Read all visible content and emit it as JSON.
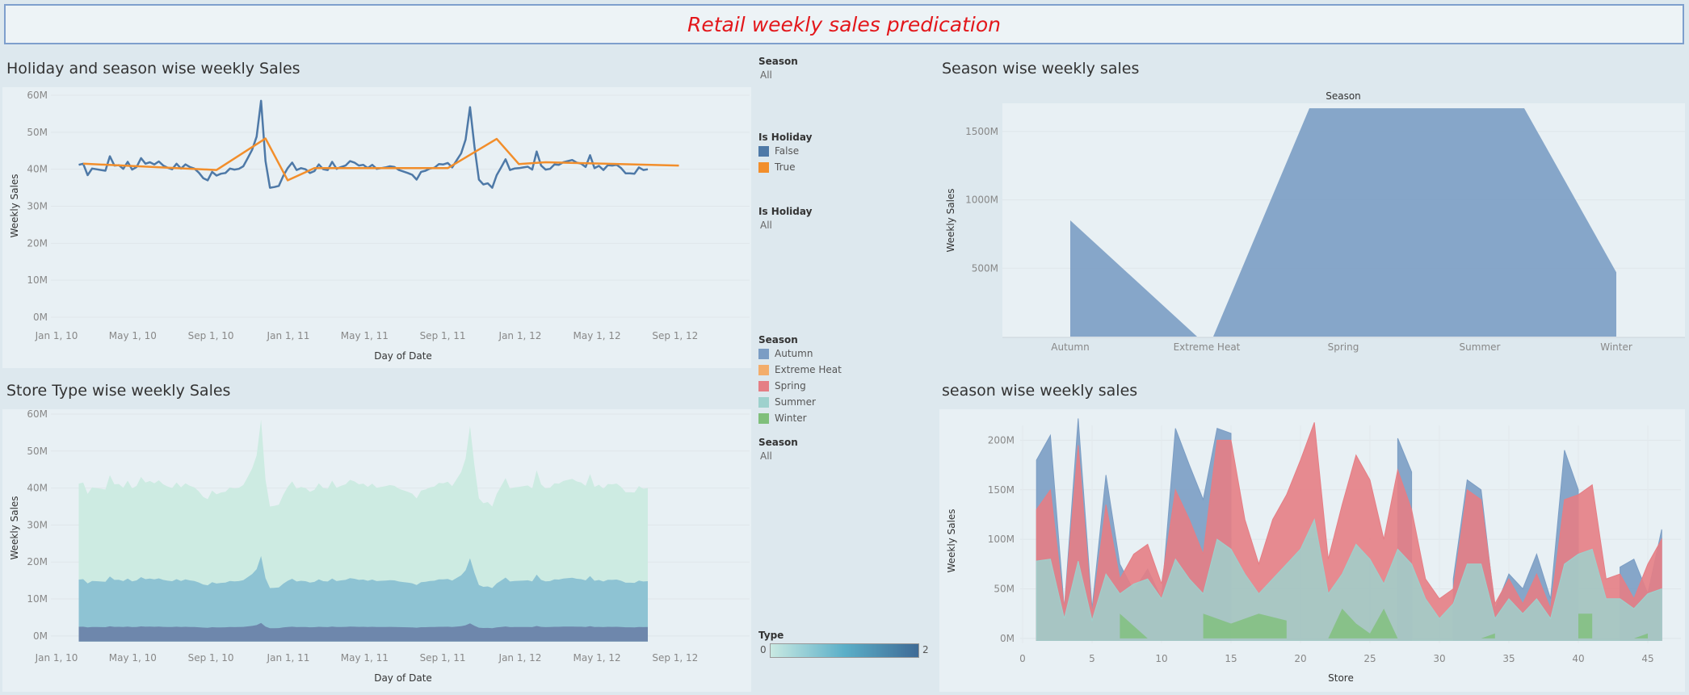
{
  "dashboard_title": "Retail weekly sales predication",
  "filters": {
    "season_filter": {
      "label": "Season",
      "value": "All"
    },
    "holiday_legend": {
      "label": "Is Holiday",
      "items": [
        {
          "name": "False",
          "color": "#4e79a7"
        },
        {
          "name": "True",
          "color": "#f28e2b"
        }
      ]
    },
    "holiday_filter": {
      "label": "Is Holiday",
      "value": "All"
    },
    "season_legend": {
      "label": "Season",
      "items": [
        {
          "name": "Autumn",
          "color": "#7b9dc4"
        },
        {
          "name": "Extreme Heat",
          "color": "#f3ad6b"
        },
        {
          "name": "Spring",
          "color": "#e57e85"
        },
        {
          "name": "Summer",
          "color": "#9ed1cd"
        },
        {
          "name": "Winter",
          "color": "#7fbf7b"
        }
      ]
    },
    "season_filter2": {
      "label": "Season",
      "value": "All"
    },
    "type_legend": {
      "label": "Type",
      "min": "0",
      "max": "2"
    }
  },
  "chart_data": [
    {
      "id": "holiday",
      "type": "line",
      "title": "Holiday and season wise weekly Sales",
      "xlabel": "Day of Date",
      "ylabel": "Weekly Sales",
      "x_ticks": [
        "Jan 1, 10",
        "May 1, 10",
        "Sep 1, 10",
        "Jan 1, 11",
        "May 1, 11",
        "Sep 1, 11",
        "Jan 1, 12",
        "May 1, 12",
        "Sep 1, 12"
      ],
      "y_ticks": [
        "0M",
        "10M",
        "20M",
        "30M",
        "40M",
        "50M",
        "60M"
      ],
      "ylim": [
        0,
        60
      ],
      "series": [
        {
          "name": "False",
          "color": "#4e79a7",
          "x_start": "2010-02-05",
          "step_days": 7,
          "values": [
            41.2,
            41.5,
            38.4,
            40.2,
            40.0,
            39.8,
            39.6,
            43.5,
            41.0,
            41.1,
            40.1,
            42.0,
            39.9,
            40.6,
            43.0,
            41.5,
            41.9,
            41.3,
            42.1,
            41.0,
            40.4,
            40.0,
            41.5,
            40.2,
            41.3,
            40.6,
            40.2,
            39.1,
            37.6,
            37.0,
            39.3,
            38.3,
            38.8,
            39.0,
            40.2,
            39.9,
            40.1,
            40.8,
            43.0,
            45.3,
            48.8,
            58.5,
            42.2,
            35.0,
            35.2,
            35.5,
            38.2,
            40.3,
            41.8,
            39.8,
            40.3,
            40.0,
            39.0,
            39.5,
            41.3,
            40.0,
            39.8,
            42.0,
            40.1,
            40.6,
            41.0,
            42.2,
            41.8,
            41.0,
            41.2,
            40.3,
            41.2,
            40.1,
            40.3,
            40.5,
            40.8,
            40.6,
            39.8,
            39.4,
            39.0,
            38.5,
            37.2,
            39.3,
            39.6,
            40.2,
            40.4,
            41.4,
            41.3,
            41.7,
            40.5,
            42.4,
            44.3,
            48.0,
            56.8,
            46.1,
            37.2,
            35.9,
            36.2,
            35.0,
            38.4,
            40.5,
            42.7,
            39.8,
            40.2,
            40.3,
            40.5,
            40.7,
            39.9,
            44.8,
            41.0,
            39.9,
            40.1,
            41.3,
            41.2,
            41.9,
            42.2,
            42.5,
            41.8,
            41.5,
            40.6,
            43.8,
            40.3,
            40.9,
            39.8,
            41.1,
            41.0,
            41.2,
            40.3,
            38.9,
            38.9,
            38.8,
            40.5,
            39.8,
            40.0
          ]
        },
        {
          "name": "True",
          "color": "#f28e2b",
          "points": [
            [
              "2010-02-12",
              41.5
            ],
            [
              "2010-09-10",
              39.8
            ],
            [
              "2010-11-26",
              48.3
            ],
            [
              "2010-12-31",
              37.0
            ],
            [
              "2011-02-11",
              40.3
            ],
            [
              "2011-09-09",
              40.3
            ],
            [
              "2011-11-25",
              48.2
            ],
            [
              "2011-12-30",
              41.4
            ],
            [
              "2012-02-10",
              41.9
            ],
            [
              "2012-09-07",
              41.0
            ]
          ]
        }
      ]
    },
    {
      "id": "season_area",
      "type": "area",
      "title": "Season wise weekly sales",
      "header": "Season",
      "ylabel": "Weekly Sales",
      "categories": [
        "Autumn",
        "Extreme Heat",
        "Spring",
        "Summer",
        "Winter"
      ],
      "y_ticks": [
        "500M",
        "1000M",
        "1500M"
      ],
      "ylim": [
        0,
        1700
      ],
      "values": [
        850,
        0,
        1670,
        1670,
        470
      ],
      "color": "#7b9dc4"
    },
    {
      "id": "store_type",
      "type": "area",
      "title": "Store Type wise weekly Sales",
      "xlabel": "Day of Date",
      "ylabel": "Weekly Sales",
      "x_ticks": [
        "Jan 1, 10",
        "May 1, 10",
        "Sep 1, 10",
        "Jan 1, 11",
        "May 1, 11",
        "Sep 1, 11",
        "Jan 1, 12",
        "May 1, 12",
        "Sep 1, 12"
      ],
      "y_ticks": [
        "0M",
        "10M",
        "20M",
        "30M",
        "40M",
        "50M",
        "60M"
      ],
      "ylim": [
        -2,
        60
      ],
      "layers": [
        {
          "name": "2",
          "color": "#6e87ac",
          "value_ratio": 0.06
        },
        {
          "name": "1",
          "color": "#8ec3d3",
          "value_ratio": 0.37
        },
        {
          "name": "0",
          "color": "#cdebe2",
          "value_ratio": 1.0
        }
      ]
    },
    {
      "id": "store_season",
      "type": "area",
      "title": "season wise weekly sales",
      "xlabel": "Store",
      "ylabel": "Weekly Sales",
      "x_ticks": [
        "0",
        "5",
        "10",
        "15",
        "20",
        "25",
        "30",
        "35",
        "40",
        "45"
      ],
      "xlim": [
        0,
        45
      ],
      "y_ticks": [
        "0M",
        "50M",
        "100M",
        "150M",
        "200M"
      ],
      "ylim": [
        -5,
        215
      ],
      "series": [
        {
          "name": "Autumn",
          "color": "#7b9dc4",
          "values": [
            180,
            205,
            30,
            222,
            30,
            165,
            75,
            48,
            70,
            40,
            212,
            175,
            140,
            212,
            207,
            null,
            null,
            null,
            null,
            null,
            null,
            null,
            null,
            null,
            null,
            null,
            202,
            168,
            null,
            null,
            60,
            160,
            150,
            30,
            65,
            50,
            85,
            40,
            190,
            150,
            null,
            null,
            72,
            80,
            45,
            110
          ]
        },
        {
          "name": "Spring",
          "color": "#e57e85",
          "values": [
            130,
            150,
            30,
            195,
            25,
            135,
            60,
            85,
            95,
            55,
            150,
            120,
            85,
            200,
            200,
            120,
            75,
            120,
            145,
            180,
            218,
            80,
            135,
            185,
            160,
            100,
            170,
            130,
            60,
            40,
            50,
            150,
            140,
            35,
            60,
            35,
            65,
            30,
            140,
            145,
            155,
            60,
            65,
            40,
            75,
            100
          ]
        },
        {
          "name": "Summer",
          "color": "#9ed1cd",
          "values": [
            78,
            80,
            20,
            78,
            18,
            65,
            45,
            55,
            60,
            40,
            80,
            60,
            45,
            100,
            90,
            65,
            45,
            60,
            75,
            90,
            120,
            45,
            65,
            95,
            80,
            55,
            90,
            75,
            40,
            20,
            35,
            75,
            75,
            20,
            40,
            25,
            40,
            20,
            75,
            85,
            90,
            40,
            40,
            30,
            45,
            50
          ]
        },
        {
          "name": "Winter",
          "color": "#7fbf7b",
          "segments": [
            [
              [
                7,
                0
              ],
              [
                7,
                25
              ],
              [
                9,
                0
              ]
            ],
            [
              [
                13,
                0
              ],
              [
                13,
                25
              ],
              [
                15,
                15
              ],
              [
                17,
                25
              ],
              [
                19,
                18
              ],
              [
                19,
                0
              ]
            ],
            [
              [
                22,
                0
              ],
              [
                23,
                30
              ],
              [
                24,
                15
              ],
              [
                25,
                5
              ],
              [
                26,
                30
              ],
              [
                27,
                0
              ]
            ],
            [
              [
                33,
                0
              ],
              [
                34,
                5
              ],
              [
                34,
                0
              ]
            ],
            [
              [
                40,
                0
              ],
              [
                40,
                25
              ],
              [
                41,
                25
              ],
              [
                41,
                0
              ]
            ],
            [
              [
                44,
                0
              ],
              [
                45,
                5
              ],
              [
                45,
                0
              ]
            ]
          ]
        },
        {
          "name": "Extreme Heat",
          "color": "#f3ad6b",
          "values": []
        }
      ]
    }
  ]
}
